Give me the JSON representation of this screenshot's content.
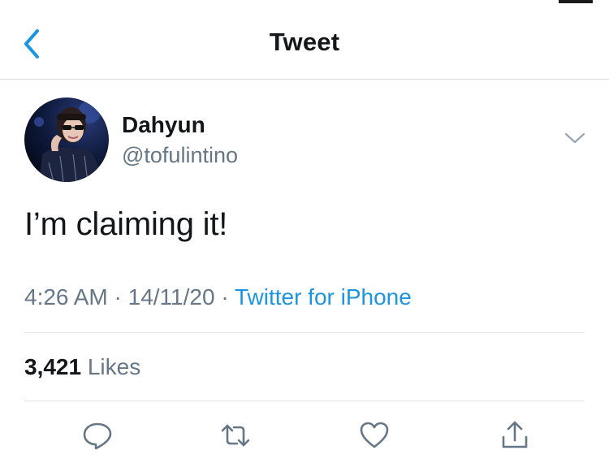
{
  "header": {
    "title": "Tweet",
    "back_icon": "chevron-left-icon"
  },
  "tweet": {
    "author_name": "Dahyun",
    "author_handle": "@tofulintino",
    "text": "I’m claiming it!",
    "time": "4:26 AM",
    "date": "14/11/20",
    "separator": " · ",
    "source": "Twitter for iPhone",
    "likes_count": "3,421",
    "likes_label": "Likes"
  },
  "actions": [
    "reply-icon",
    "retweet-icon",
    "like-icon",
    "share-icon"
  ],
  "colors": {
    "accent": "#1b95e0",
    "secondary_text": "#657786",
    "divider": "#e1e8ed"
  }
}
